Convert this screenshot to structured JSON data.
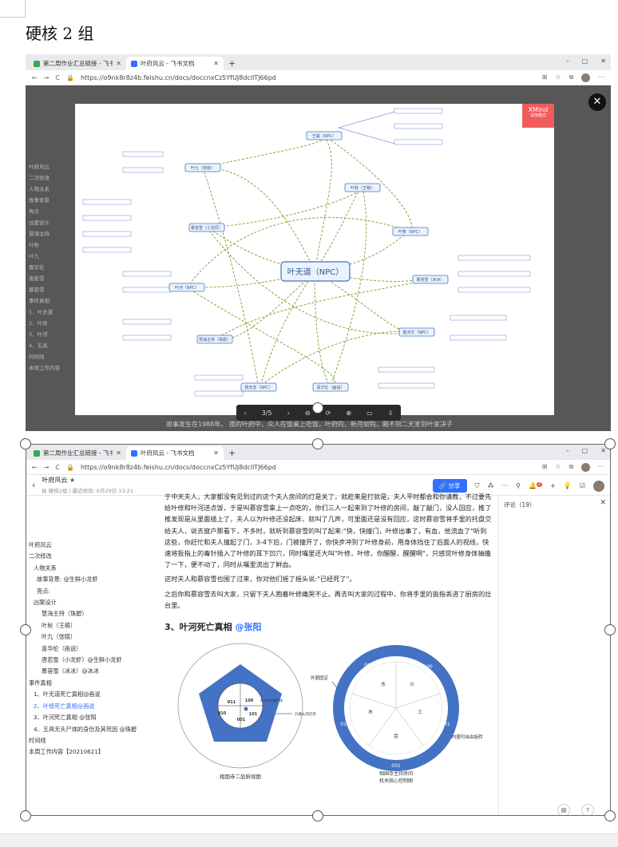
{
  "heading": "硬核 2 组",
  "browser": {
    "tab1": "第二周作业汇总链接 - 飞书文档",
    "tab2": "叶府风云 - 飞书文档",
    "url": "https://o9nk8r8z4b.feishu.cn/docs/doccnxCz5YfUJ8dcllTJ66pd",
    "minimize": "–",
    "restore": "▢",
    "close": "✕",
    "new_tab": "+",
    "back": "←",
    "forward": "→",
    "reload": "C"
  },
  "viewer": {
    "pager": "3/5",
    "prev": "‹",
    "next": "›",
    "zoom_out": "⊖",
    "zoom_in": "⊕",
    "close": "✕",
    "xmind_logo": "XMind",
    "xmind_trial": "试用模式",
    "behind_text": "故事发生在1988年。 夜的叶府中，众人在饭桌上吃饭，叶府的，新月如钩，黯不到二天室到叶家决子",
    "mindmap": {
      "center": "叶无道（NPC）",
      "nodes": [
        "王崩（NPC）",
        "叶九（张晓）",
        "叶秋（王萌）",
        "叶筝（NPC）",
        "慕容雪（小龙虾）",
        "慕容雪（冰冰）",
        "叶河（NPC）",
        "楚鸿文（NPC）",
        "慧海主持（珠碧）",
        "喜华伦（画说）",
        "杨无音（NPC）"
      ]
    }
  },
  "app": {
    "doc_title": "叶府风云",
    "star": "★",
    "meta": "▤ 硬核2组  |  最近修改: 6月29日 13:21",
    "share": "分享",
    "notif_count": "2",
    "comments": "评论（19）"
  },
  "toc": [
    {
      "t": "叶府风云",
      "lvl": "l1"
    },
    {
      "t": "二次修改",
      "lvl": "l1"
    },
    {
      "t": "人物关系",
      "lvl": "l2"
    },
    {
      "t": "故事背景: @生鲜小龙虾",
      "lvl": "l3"
    },
    {
      "t": "亮点:",
      "lvl": "l3"
    },
    {
      "t": "凶案设计",
      "lvl": "l2"
    },
    {
      "t": "慧海主持（珠碧）",
      "lvl": "l4"
    },
    {
      "t": "叶秋（王萌）",
      "lvl": "l4"
    },
    {
      "t": "叶九（张晓）",
      "lvl": "l4"
    },
    {
      "t": "喜华伦（画说）",
      "lvl": "l4"
    },
    {
      "t": "唐若雪（小龙虾）@生鲜小龙虾",
      "lvl": "l4"
    },
    {
      "t": "慕容雪（冰冰）@冰冰",
      "lvl": "l4"
    },
    {
      "t": "事件真相",
      "lvl": "l1"
    },
    {
      "t": "1、叶无道死亡真相@画说",
      "lvl": "l2"
    },
    {
      "t": "2、叶修死亡真相@画说",
      "lvl": "l2 act"
    },
    {
      "t": "3、叶河死亡真相 @张阳",
      "lvl": "l2"
    },
    {
      "t": "4、五具无头尸体的身份及其死因 @珠碧",
      "lvl": "l2"
    },
    {
      "t": "时间线",
      "lvl": "l1"
    },
    {
      "t": "本周工作内容【20210621】",
      "lvl": "l1"
    }
  ],
  "content": {
    "p1": "于中天夫人，大家都没有见到过的这个夫人房间的灯是关了，就趁来是打就是，夫人平时都会和你请教，不过要先给叶修和叶河送点饭，于是叫慕容雪拿上一点吃的，你们三人一起来到了叶修的房间，敲了敲门，没人回应，推了推发现是从里面插上了，夫人以为叶修还没起床，就叫了几声，可里面还是没有回应，这时慕容雪将手里的托盘交给夫人，说去窗户那看下，不多时，就听到慕容雪的叫了起来:\"快，快撞门，叶修出事了，有血，他流血了\"听到这些，你赶忙和夫人撞起了门，3-4下后，门被撞开了，你快步冲到了叶修身前，用身体挡住了后面人的视线，快速将扳指上的毒针插入了叶修的耳下凹穴，同时嘴里还大叫\"叶修，叶修，你醒醒，醒醒啊\"，只感觉叶修身体抽搐了一下，便不动了，同时从嘴里流出了鲜血。",
    "p2": "这时夫人和慕容雪也围了过来，你对他们摇了摇头说:\"已经死了\"。",
    "p3": "之后你和慕容雪去叫大家，只留下夫人抱着叶修痛哭不止。再去叫大家的过程中，你将手里的扳指丢进了厨房的灶台里。",
    "h3": "3、叶河死亡真相",
    "h3_at": "@张阳",
    "fig_left": {
      "caption": "相国寺二层俯视图",
      "codes": [
        "011",
        "100",
        "010",
        "101",
        "001"
      ],
      "arrow_label": "只要从内打开",
      "side_label": "叶河与七妹尸体"
    },
    "fig_right": {
      "caption1": "相国寺主持房间",
      "caption2": "机关核心控制图",
      "outer_label": "外圈固定",
      "inner_label": "内圈可自由旋转",
      "ring_codes": [
        "011",
        "100",
        "101",
        "001",
        "010"
      ],
      "elements": [
        "水",
        "火",
        "土",
        "金",
        "木"
      ],
      "ring_color": "#4472c4"
    }
  }
}
